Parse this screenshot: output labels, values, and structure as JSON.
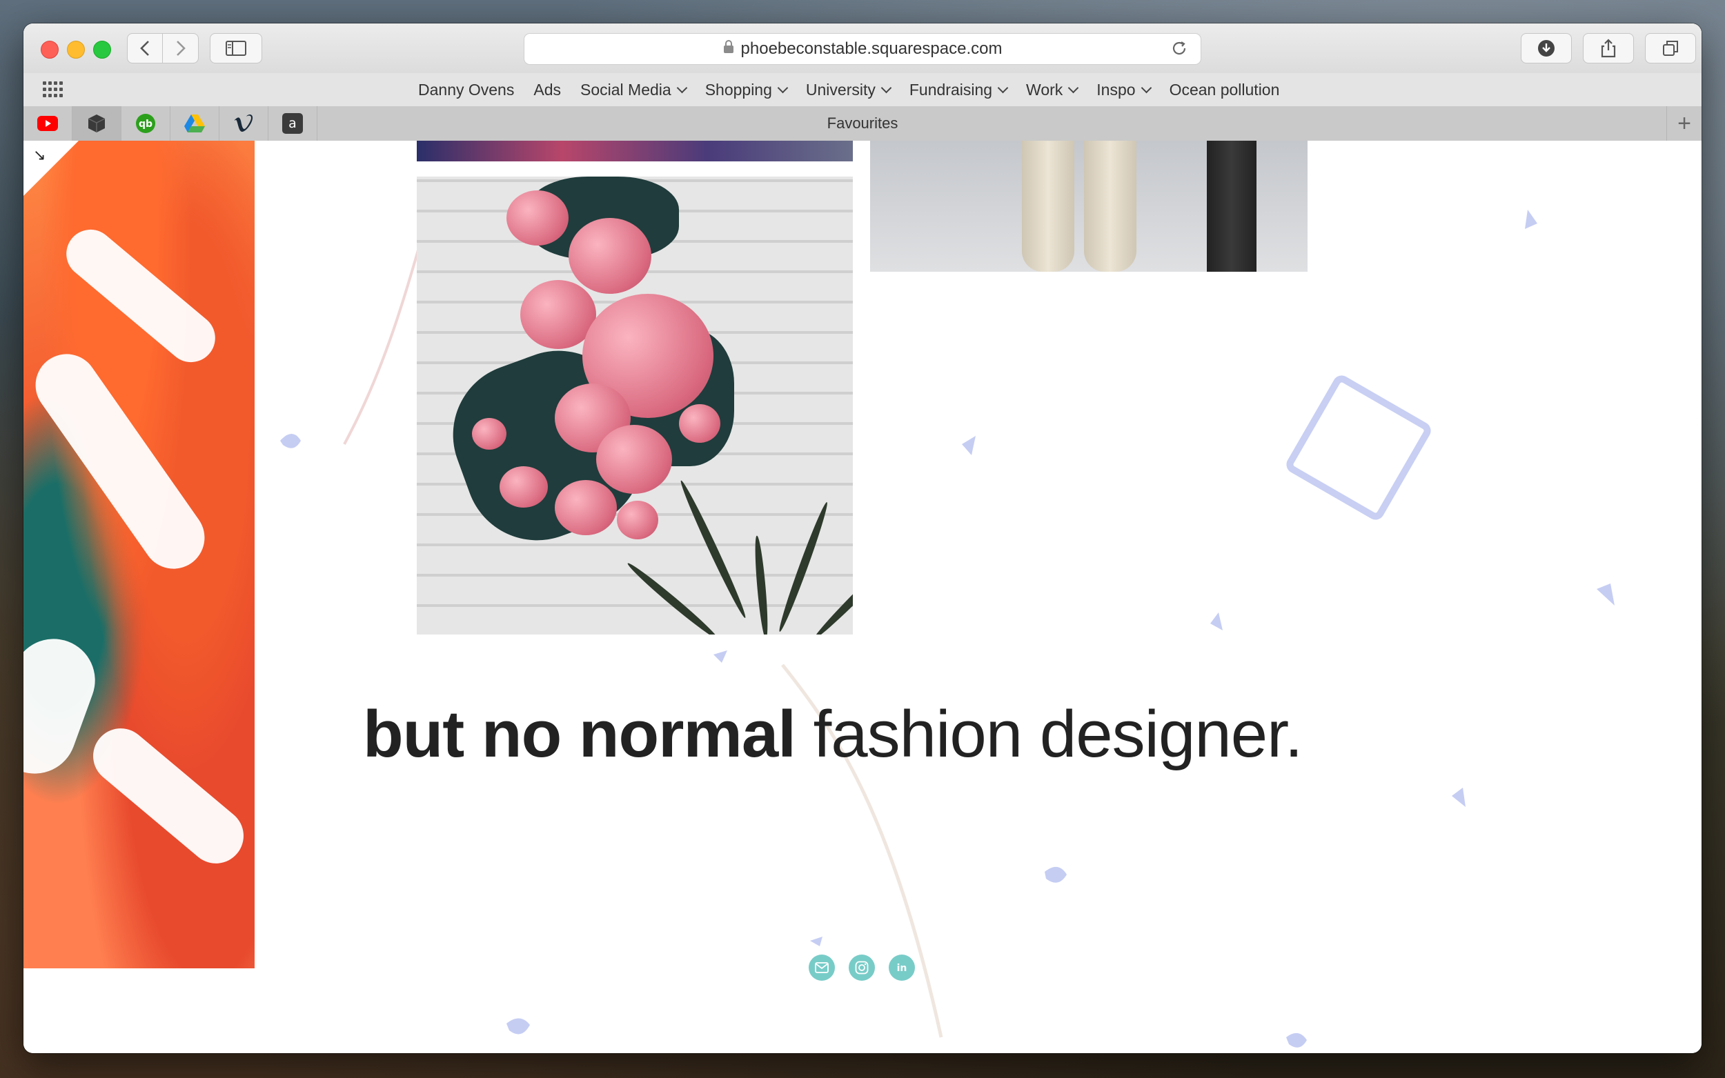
{
  "browser": {
    "url": "phoebeconstable.squarespace.com",
    "favourites_label": "Favourites"
  },
  "bookmarks": [
    {
      "label": "Danny Ovens",
      "dropdown": false
    },
    {
      "label": "Ads",
      "dropdown": false
    },
    {
      "label": "Social Media",
      "dropdown": true
    },
    {
      "label": "Shopping",
      "dropdown": true
    },
    {
      "label": "University",
      "dropdown": true
    },
    {
      "label": "Fundraising",
      "dropdown": true
    },
    {
      "label": "Work",
      "dropdown": true
    },
    {
      "label": "Inspo",
      "dropdown": true
    },
    {
      "label": "Ocean pollution",
      "dropdown": false
    }
  ],
  "pinned_tabs": [
    "youtube-icon",
    "cube-icon",
    "quickbooks-icon",
    "google-drive-icon",
    "vimeo-icon",
    "amazon-icon"
  ],
  "page": {
    "headline_bold": "but no normal",
    "headline_light": "fashion designer.",
    "social": [
      "email-icon",
      "instagram-icon",
      "linkedin-icon"
    ]
  },
  "colors": {
    "social_accent": "#78ccc8",
    "headline": "#222222"
  }
}
